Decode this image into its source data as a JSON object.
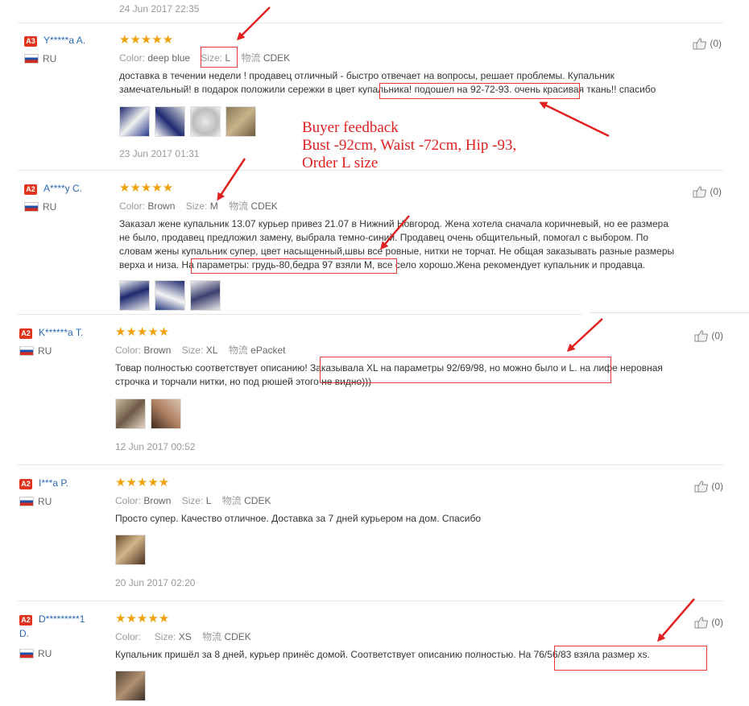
{
  "top_date": "24 Jun 2017 22:35",
  "labels": {
    "color": "Color:",
    "size": "Size:",
    "shipping": "物流"
  },
  "helpful_count": "(0)",
  "callout": {
    "line1": "Buyer feedback",
    "line2": "Bust -92cm, Waist -72cm, Hip -93,",
    "line3": "Order L size"
  },
  "reviews": [
    {
      "level": "A3",
      "user": "Y*****a A.",
      "country": "RU",
      "stars": "★★★★★",
      "color": "deep blue",
      "size": "L",
      "shipping": "CDEK",
      "text_lines": [
        "доставка в течении недели ! продавец отличный - быстро отвечает на вопросы, решает проблемы. Купальник",
        "замечательный! в подарок положили сережки в цвет купальника! подошел на 92-72-93. очень красивая ткань!! спасибо"
      ],
      "date": "23 Jun 2017 01:31"
    },
    {
      "level": "A2",
      "user": "A****y C.",
      "country": "RU",
      "stars": "★★★★★",
      "color": "Brown",
      "size": "M",
      "shipping": "CDEK",
      "text_lines": [
        "Заказал жене купальник 13.07 курьер привез 21.07 в Нижний Новгород. Жена хотела сначала коричневый, но ее размера",
        "не было, продавец предложил замену, выбрала темно-синий. Продавец очень общительный, помогал с выбором. По",
        "словам жены купальник супер, цвет насыщенный,швы все ровные, нитки не торчат. Не общая заказывать разные размеры",
        "верха и низа. На параметры: грудь-80,бедра 97 взяли М, все село хорошо.Жена рекомендует купальник и продавца."
      ],
      "date": ""
    },
    {
      "level": "A2",
      "user": "K******a T.",
      "country": "RU",
      "stars": "★★★★★",
      "color": "Brown",
      "size": "XL",
      "shipping": "ePacket",
      "text_lines": [
        "Товар полностью соответствует описанию! Заказывала XL на параметры 92/69/98, но можно было и L. на лифе неровная",
        "строчка и торчали нитки, но под рюшей этого не видно)))"
      ],
      "date": "12 Jun 2017 00:52"
    },
    {
      "level": "A2",
      "user": "I***a P.",
      "country": "RU",
      "stars": "★★★★★",
      "color": "Brown",
      "size": "L",
      "shipping": "CDEK",
      "text_lines": [
        "Просто супер. Качество отличное. Доставка за 7 дней курьером на дом. Спасибо"
      ],
      "date": "20 Jun 2017 02:20"
    },
    {
      "level": "A2",
      "user": "D*********1",
      "user_line2": "D.",
      "country": "RU",
      "stars": "★★★★★",
      "color": "",
      "size": "XS",
      "shipping": "CDEK",
      "text_lines": [
        "Купальник пришёл за 8 дней, курьер принёс домой. Соответствует описанию полностью. На 76/56/83 взяла размер xs."
      ],
      "date": ""
    }
  ]
}
